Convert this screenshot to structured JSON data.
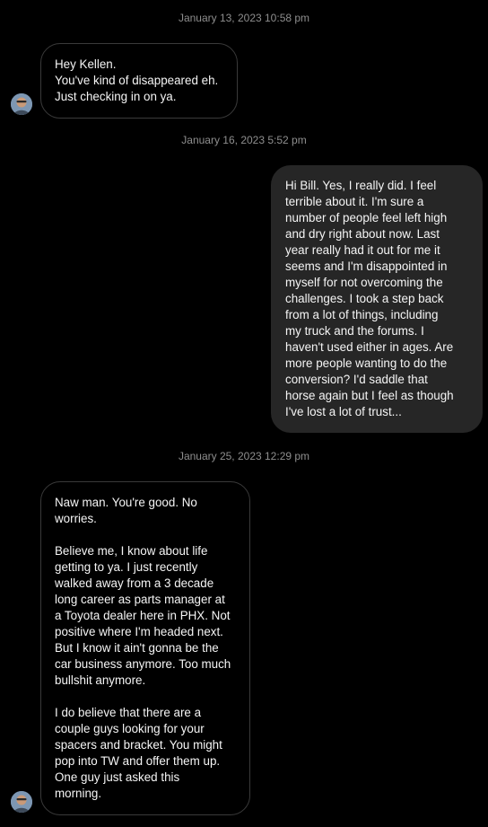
{
  "conversation": {
    "timestamps": [
      "January 13, 2023 10:58 pm",
      "January 16, 2023 5:52 pm",
      "January 25, 2023 12:29 pm"
    ],
    "messages": [
      {
        "from": "other",
        "text": "Hey Kellen.\nYou've kind of disappeared eh.\nJust checking in on ya."
      },
      {
        "from": "me",
        "text": "Hi Bill. Yes, I really did. I feel\nterrible about it. I'm sure a\nnumber of people feel left high\nand dry right about now. Last\nyear really had it out for me it\nseems and I'm disappointed in\nmyself for not overcoming the\nchallenges. I took a step back\nfrom a lot of things, including\nmy truck and the forums. I\nhaven't used either in ages. Are\nmore people wanting to do the\nconversion? I'd saddle that\nhorse again but I feel as though\nI've lost a lot of trust..."
      },
      {
        "from": "other",
        "text": "Naw man. You're good. No\nworries.\n\nBelieve me, I know about life\ngetting to ya. I just recently\nwalked away from a 3 decade\nlong career as parts manager at\na Toyota dealer here in PHX. Not\npositive where I'm headed next.\nBut I know it ain't gonna be the\ncar business anymore. Too much\nbullshit anymore.\n\nI do believe that there are a\ncouple guys looking for your\nspacers and bracket. You might\npop into TW and offer them up.\nOne guy just asked this\nmorning."
      }
    ]
  },
  "icons": {
    "avatar": "profile-photo"
  },
  "colors": {
    "background": "#000000",
    "outgoing_bubble": "#262626",
    "incoming_border": "#3a3a3a",
    "timestamp_text": "#8e8e8e",
    "message_text": "#f5f5f5"
  }
}
